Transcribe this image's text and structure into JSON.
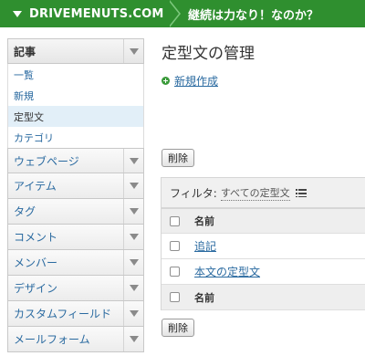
{
  "topbar": {
    "site_name": "DRIVEMENUTS.COM",
    "blog_title": "継続は力なり！なのか？",
    "color": "#2f8f2f"
  },
  "sidebar": {
    "header": "記事",
    "sub_items": [
      {
        "label": "一覧"
      },
      {
        "label": "新規"
      },
      {
        "label": "定型文",
        "active": true
      },
      {
        "label": "カテゴリ"
      }
    ],
    "menu_items": [
      {
        "label": "ウェブページ"
      },
      {
        "label": "アイテム"
      },
      {
        "label": "タグ"
      },
      {
        "label": "コメント"
      },
      {
        "label": "メンバー"
      },
      {
        "label": "デザイン"
      },
      {
        "label": "カスタムフィールド"
      },
      {
        "label": "メールフォーム"
      }
    ]
  },
  "main": {
    "title": "定型文の管理",
    "new_link": "新規作成",
    "delete_label": "削除",
    "filter": {
      "label": "フィルタ:",
      "value": "すべての定型文"
    },
    "table": {
      "column_name": "名前",
      "rows": [
        {
          "name": "追記"
        },
        {
          "name": "本文の定型文"
        }
      ]
    }
  }
}
